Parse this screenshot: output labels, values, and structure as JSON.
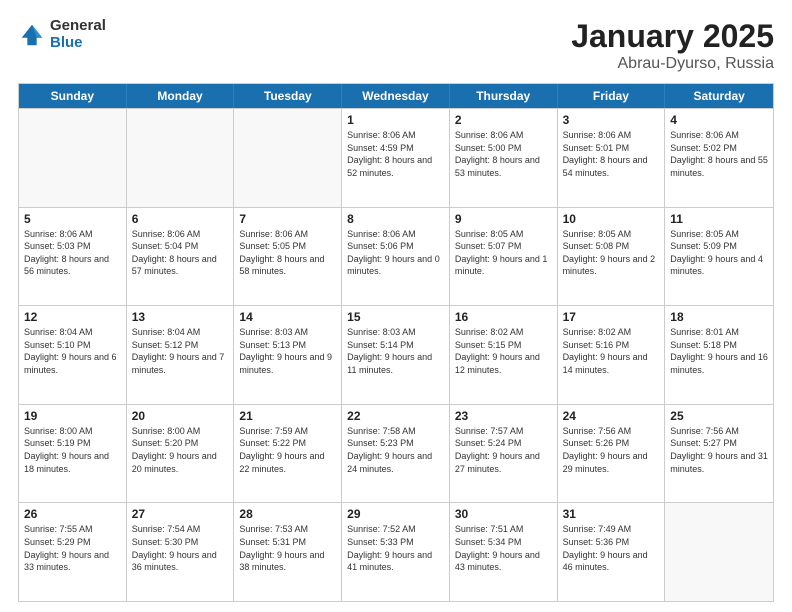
{
  "header": {
    "logo_general": "General",
    "logo_blue": "Blue",
    "title": "January 2025",
    "location": "Abrau-Dyurso, Russia"
  },
  "weekdays": [
    "Sunday",
    "Monday",
    "Tuesday",
    "Wednesday",
    "Thursday",
    "Friday",
    "Saturday"
  ],
  "weeks": [
    [
      {
        "day": "",
        "info": "",
        "empty": true
      },
      {
        "day": "",
        "info": "",
        "empty": true
      },
      {
        "day": "",
        "info": "",
        "empty": true
      },
      {
        "day": "1",
        "info": "Sunrise: 8:06 AM\nSunset: 4:59 PM\nDaylight: 8 hours\nand 52 minutes.",
        "empty": false
      },
      {
        "day": "2",
        "info": "Sunrise: 8:06 AM\nSunset: 5:00 PM\nDaylight: 8 hours\nand 53 minutes.",
        "empty": false
      },
      {
        "day": "3",
        "info": "Sunrise: 8:06 AM\nSunset: 5:01 PM\nDaylight: 8 hours\nand 54 minutes.",
        "empty": false
      },
      {
        "day": "4",
        "info": "Sunrise: 8:06 AM\nSunset: 5:02 PM\nDaylight: 8 hours\nand 55 minutes.",
        "empty": false
      }
    ],
    [
      {
        "day": "5",
        "info": "Sunrise: 8:06 AM\nSunset: 5:03 PM\nDaylight: 8 hours\nand 56 minutes.",
        "empty": false
      },
      {
        "day": "6",
        "info": "Sunrise: 8:06 AM\nSunset: 5:04 PM\nDaylight: 8 hours\nand 57 minutes.",
        "empty": false
      },
      {
        "day": "7",
        "info": "Sunrise: 8:06 AM\nSunset: 5:05 PM\nDaylight: 8 hours\nand 58 minutes.",
        "empty": false
      },
      {
        "day": "8",
        "info": "Sunrise: 8:06 AM\nSunset: 5:06 PM\nDaylight: 9 hours\nand 0 minutes.",
        "empty": false
      },
      {
        "day": "9",
        "info": "Sunrise: 8:05 AM\nSunset: 5:07 PM\nDaylight: 9 hours\nand 1 minute.",
        "empty": false
      },
      {
        "day": "10",
        "info": "Sunrise: 8:05 AM\nSunset: 5:08 PM\nDaylight: 9 hours\nand 2 minutes.",
        "empty": false
      },
      {
        "day": "11",
        "info": "Sunrise: 8:05 AM\nSunset: 5:09 PM\nDaylight: 9 hours\nand 4 minutes.",
        "empty": false
      }
    ],
    [
      {
        "day": "12",
        "info": "Sunrise: 8:04 AM\nSunset: 5:10 PM\nDaylight: 9 hours\nand 6 minutes.",
        "empty": false
      },
      {
        "day": "13",
        "info": "Sunrise: 8:04 AM\nSunset: 5:12 PM\nDaylight: 9 hours\nand 7 minutes.",
        "empty": false
      },
      {
        "day": "14",
        "info": "Sunrise: 8:03 AM\nSunset: 5:13 PM\nDaylight: 9 hours\nand 9 minutes.",
        "empty": false
      },
      {
        "day": "15",
        "info": "Sunrise: 8:03 AM\nSunset: 5:14 PM\nDaylight: 9 hours\nand 11 minutes.",
        "empty": false
      },
      {
        "day": "16",
        "info": "Sunrise: 8:02 AM\nSunset: 5:15 PM\nDaylight: 9 hours\nand 12 minutes.",
        "empty": false
      },
      {
        "day": "17",
        "info": "Sunrise: 8:02 AM\nSunset: 5:16 PM\nDaylight: 9 hours\nand 14 minutes.",
        "empty": false
      },
      {
        "day": "18",
        "info": "Sunrise: 8:01 AM\nSunset: 5:18 PM\nDaylight: 9 hours\nand 16 minutes.",
        "empty": false
      }
    ],
    [
      {
        "day": "19",
        "info": "Sunrise: 8:00 AM\nSunset: 5:19 PM\nDaylight: 9 hours\nand 18 minutes.",
        "empty": false
      },
      {
        "day": "20",
        "info": "Sunrise: 8:00 AM\nSunset: 5:20 PM\nDaylight: 9 hours\nand 20 minutes.",
        "empty": false
      },
      {
        "day": "21",
        "info": "Sunrise: 7:59 AM\nSunset: 5:22 PM\nDaylight: 9 hours\nand 22 minutes.",
        "empty": false
      },
      {
        "day": "22",
        "info": "Sunrise: 7:58 AM\nSunset: 5:23 PM\nDaylight: 9 hours\nand 24 minutes.",
        "empty": false
      },
      {
        "day": "23",
        "info": "Sunrise: 7:57 AM\nSunset: 5:24 PM\nDaylight: 9 hours\nand 27 minutes.",
        "empty": false
      },
      {
        "day": "24",
        "info": "Sunrise: 7:56 AM\nSunset: 5:26 PM\nDaylight: 9 hours\nand 29 minutes.",
        "empty": false
      },
      {
        "day": "25",
        "info": "Sunrise: 7:56 AM\nSunset: 5:27 PM\nDaylight: 9 hours\nand 31 minutes.",
        "empty": false
      }
    ],
    [
      {
        "day": "26",
        "info": "Sunrise: 7:55 AM\nSunset: 5:29 PM\nDaylight: 9 hours\nand 33 minutes.",
        "empty": false
      },
      {
        "day": "27",
        "info": "Sunrise: 7:54 AM\nSunset: 5:30 PM\nDaylight: 9 hours\nand 36 minutes.",
        "empty": false
      },
      {
        "day": "28",
        "info": "Sunrise: 7:53 AM\nSunset: 5:31 PM\nDaylight: 9 hours\nand 38 minutes.",
        "empty": false
      },
      {
        "day": "29",
        "info": "Sunrise: 7:52 AM\nSunset: 5:33 PM\nDaylight: 9 hours\nand 41 minutes.",
        "empty": false
      },
      {
        "day": "30",
        "info": "Sunrise: 7:51 AM\nSunset: 5:34 PM\nDaylight: 9 hours\nand 43 minutes.",
        "empty": false
      },
      {
        "day": "31",
        "info": "Sunrise: 7:49 AM\nSunset: 5:36 PM\nDaylight: 9 hours\nand 46 minutes.",
        "empty": false
      },
      {
        "day": "",
        "info": "",
        "empty": true
      }
    ]
  ]
}
